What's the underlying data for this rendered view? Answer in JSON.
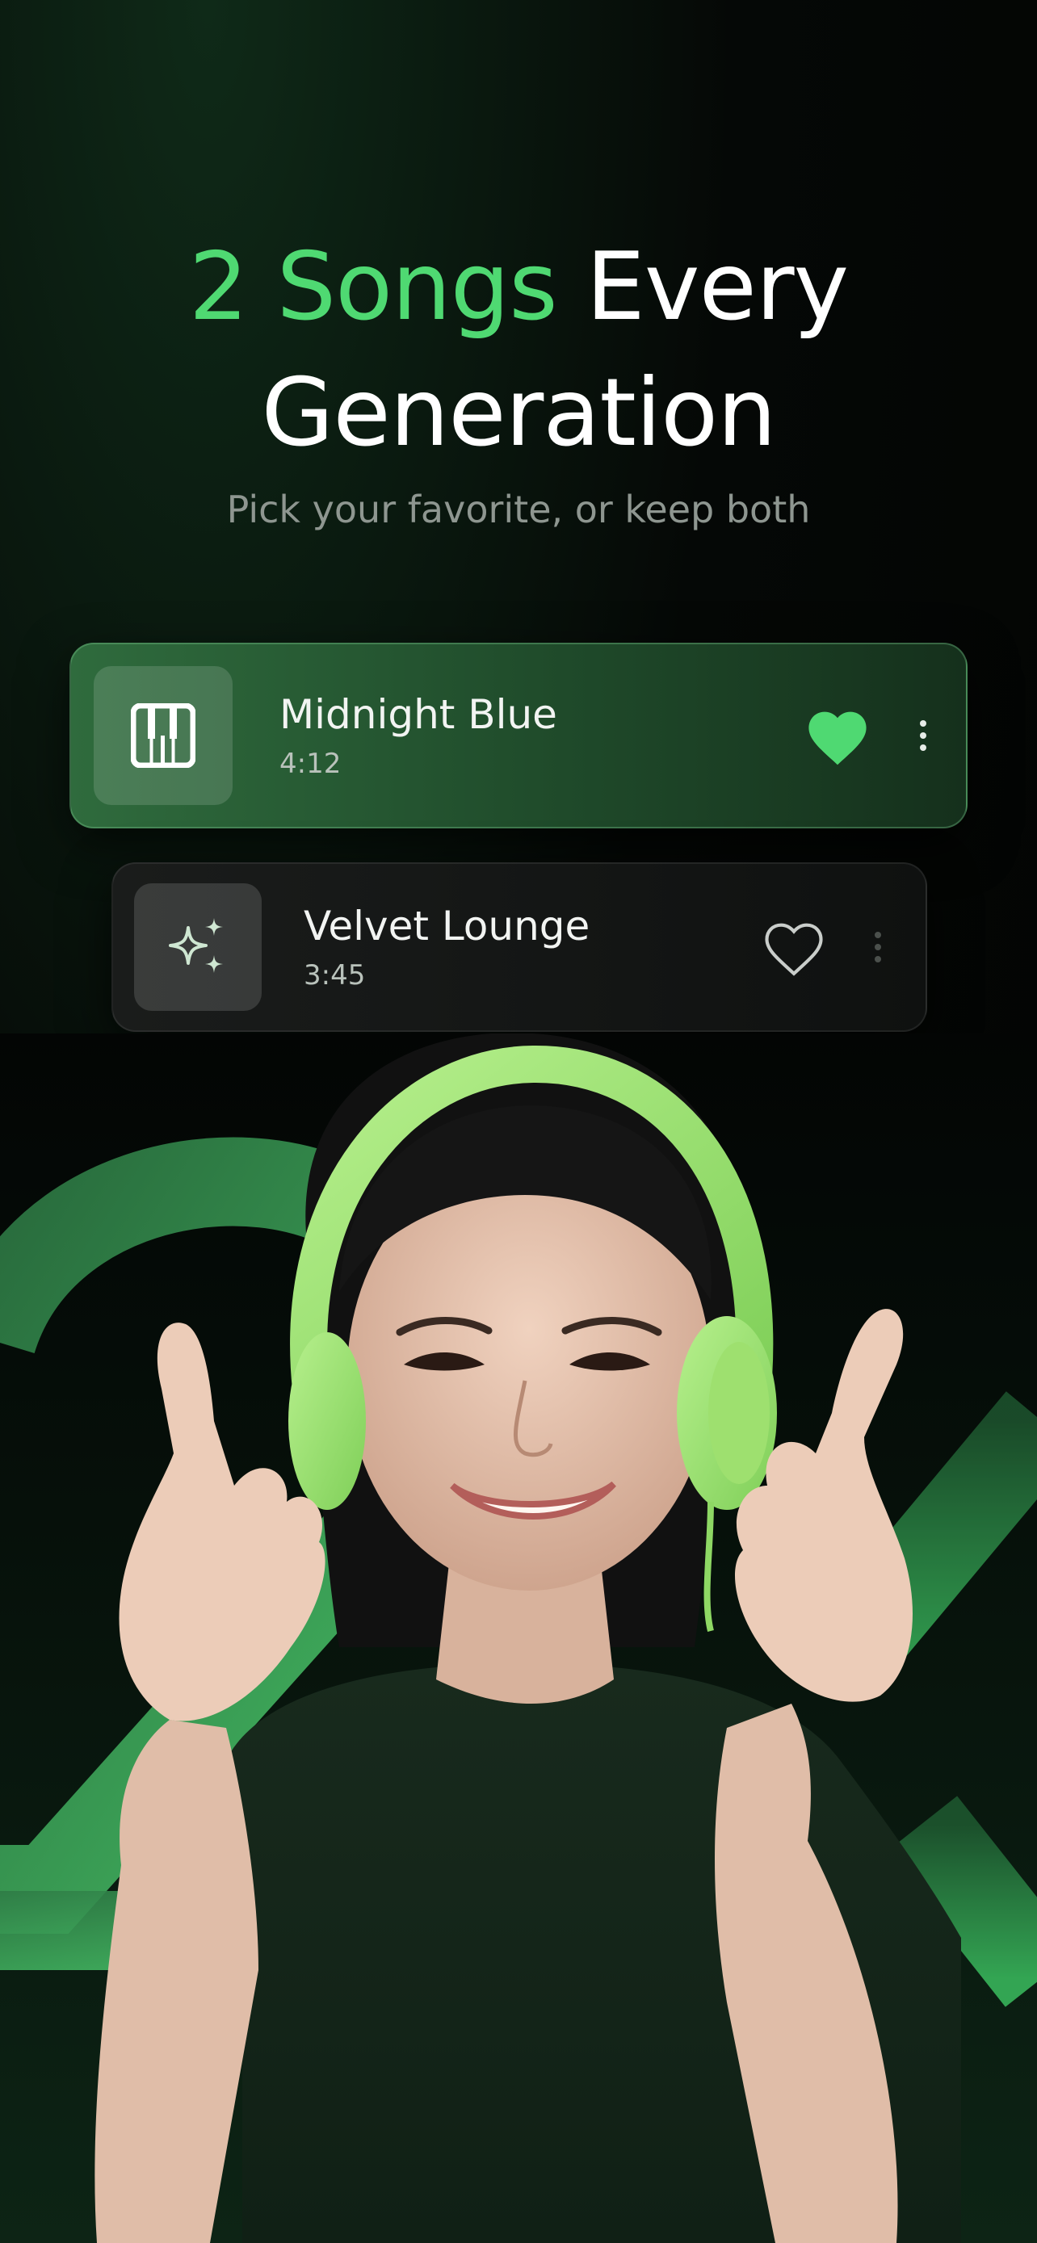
{
  "headline": {
    "accent": "2 Songs",
    "rest_line1": " Every",
    "line2": "Generation"
  },
  "subtitle": "Pick your favorite, or keep both",
  "songs": [
    {
      "title": "Midnight Blue",
      "duration": "4:12",
      "icon": "piano-icon",
      "liked": true
    },
    {
      "title": "Velvet Lounge",
      "duration": "3:45",
      "icon": "sparkles-icon",
      "liked": false
    }
  ],
  "colors": {
    "accent": "#4fd972",
    "headphones": "#9be36e"
  },
  "hero": {
    "decoration": "2x",
    "image": "woman-with-headphones"
  }
}
